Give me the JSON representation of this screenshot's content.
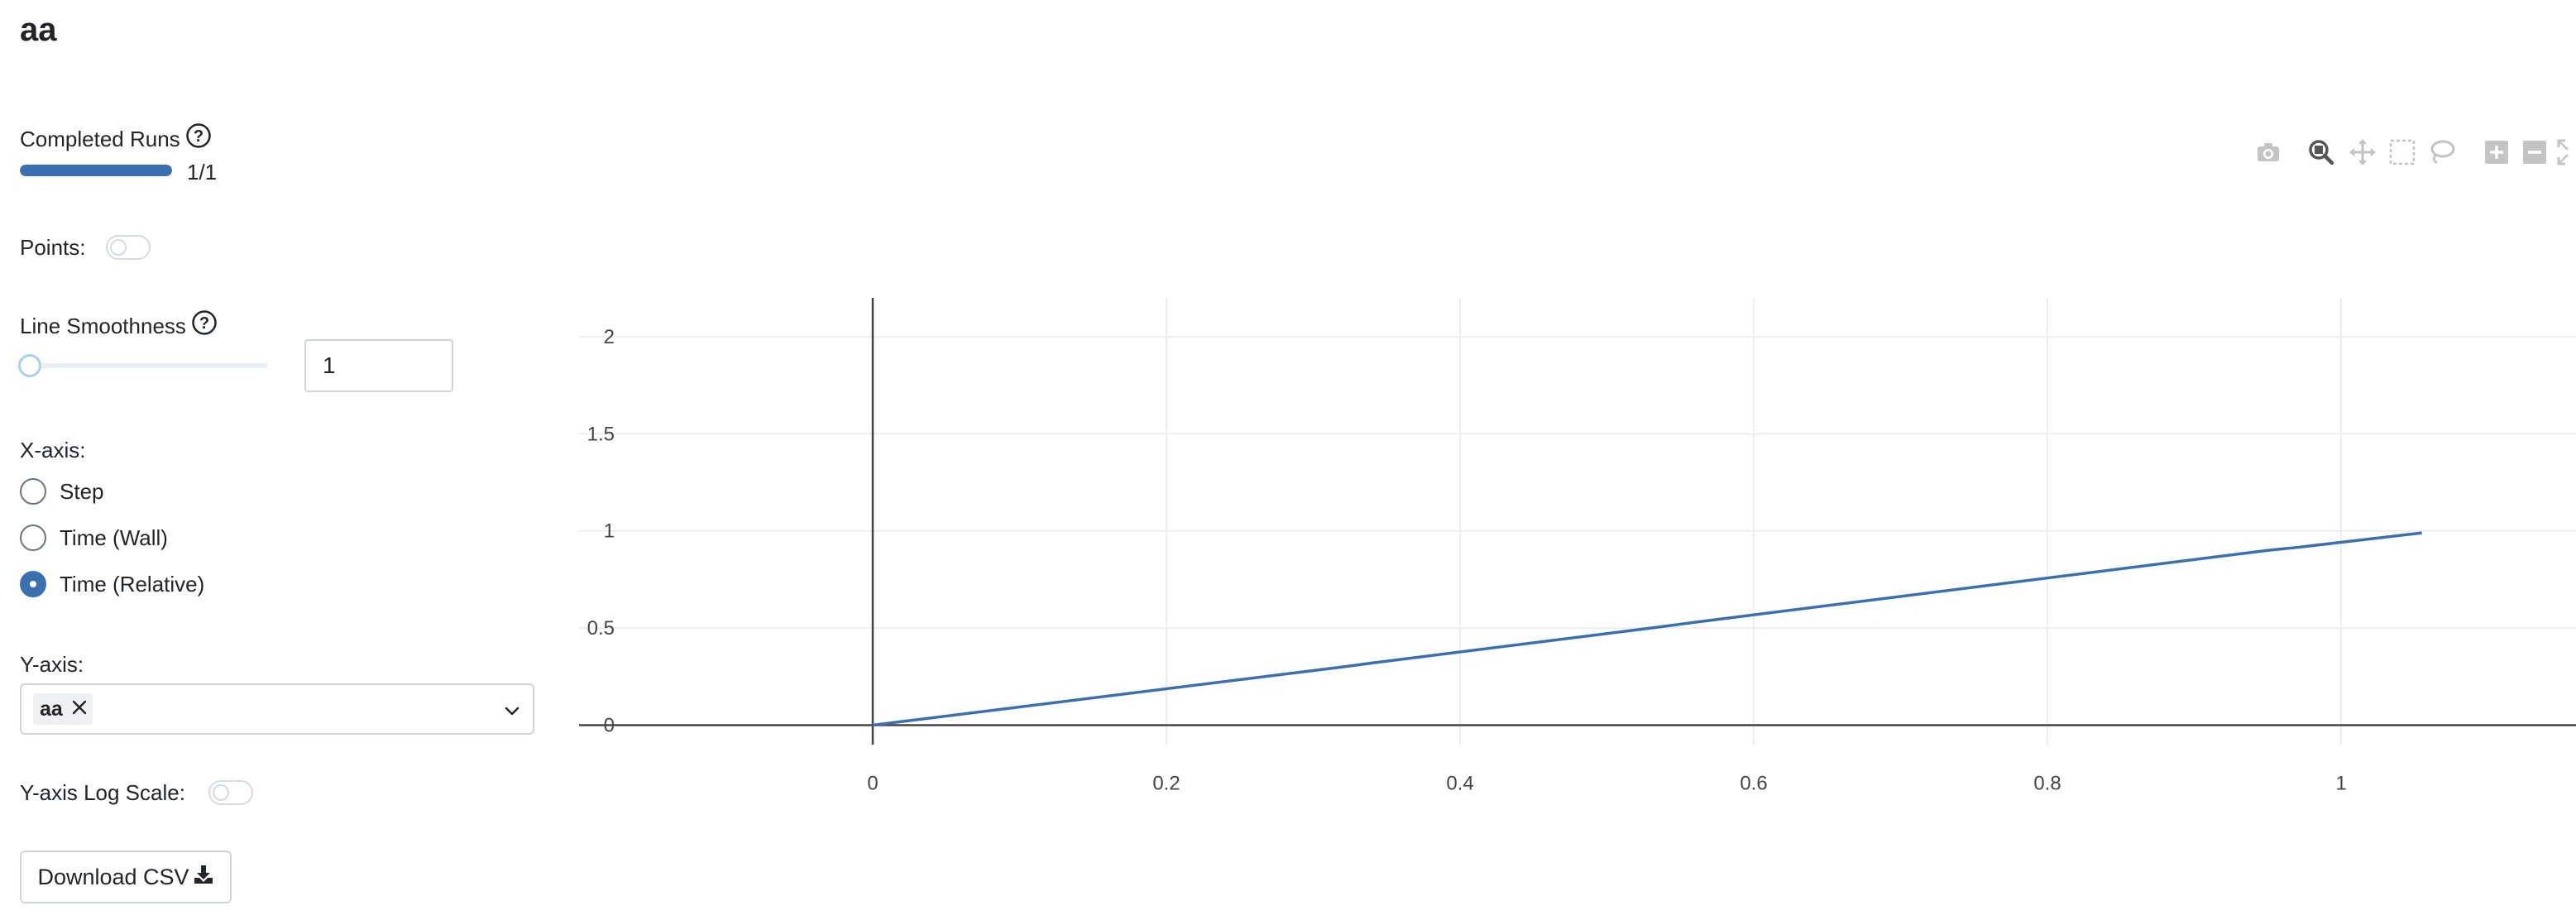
{
  "page": {
    "title": "aa"
  },
  "completed_runs": {
    "label": "Completed Runs",
    "progress_text": "1/1",
    "progress_fraction": 1.0
  },
  "points": {
    "label": "Points:",
    "enabled": false
  },
  "line_smoothness": {
    "label": "Line Smoothness",
    "slider_value": 0,
    "input_value": "1"
  },
  "x_axis": {
    "label": "X-axis:",
    "options": [
      {
        "label": "Step",
        "selected": false
      },
      {
        "label": "Time (Wall)",
        "selected": false
      },
      {
        "label": "Time (Relative)",
        "selected": true
      }
    ]
  },
  "y_axis": {
    "label": "Y-axis:",
    "selected": [
      "aa"
    ]
  },
  "log_scale": {
    "label": "Y-axis Log Scale:",
    "enabled": false
  },
  "download": {
    "label": "Download CSV"
  },
  "modebar": {
    "icons": [
      "camera-icon",
      "zoom-icon",
      "pan-icon",
      "box-select-icon",
      "lasso-icon",
      "zoom-in-icon",
      "zoom-out-icon",
      "autoscale-icon"
    ],
    "active": "zoom-icon"
  },
  "colors": {
    "accent": "#3a70b0",
    "line": "#3a70b0",
    "grid": "#eeeeee",
    "axis": "#444444"
  },
  "chart_data": {
    "type": "line",
    "title": "",
    "xlabel": "",
    "ylabel": "",
    "xlim": [
      -0.2,
      1.16
    ],
    "ylim": [
      -0.1,
      2.2
    ],
    "x_ticks": [
      0,
      0.2,
      0.4,
      0.6,
      0.8,
      1
    ],
    "x_tick_labels": [
      "0",
      "0.2",
      "0.4",
      "0.6",
      "0.8",
      "1"
    ],
    "y_ticks": [
      0,
      0.5,
      1,
      1.5,
      2
    ],
    "y_tick_labels": [
      "0",
      "0.5",
      "1",
      "1.5",
      "2"
    ],
    "grid": true,
    "legend": "none",
    "series": [
      {
        "color": "#3a70b0",
        "x": [
          0,
          0.32,
          0.34,
          0.53,
          0.56,
          0.95,
          0.97,
          1.055
        ],
        "y": [
          0,
          0.3,
          0.32,
          0.5,
          0.53,
          0.9,
          0.915,
          0.99
        ]
      }
    ]
  }
}
